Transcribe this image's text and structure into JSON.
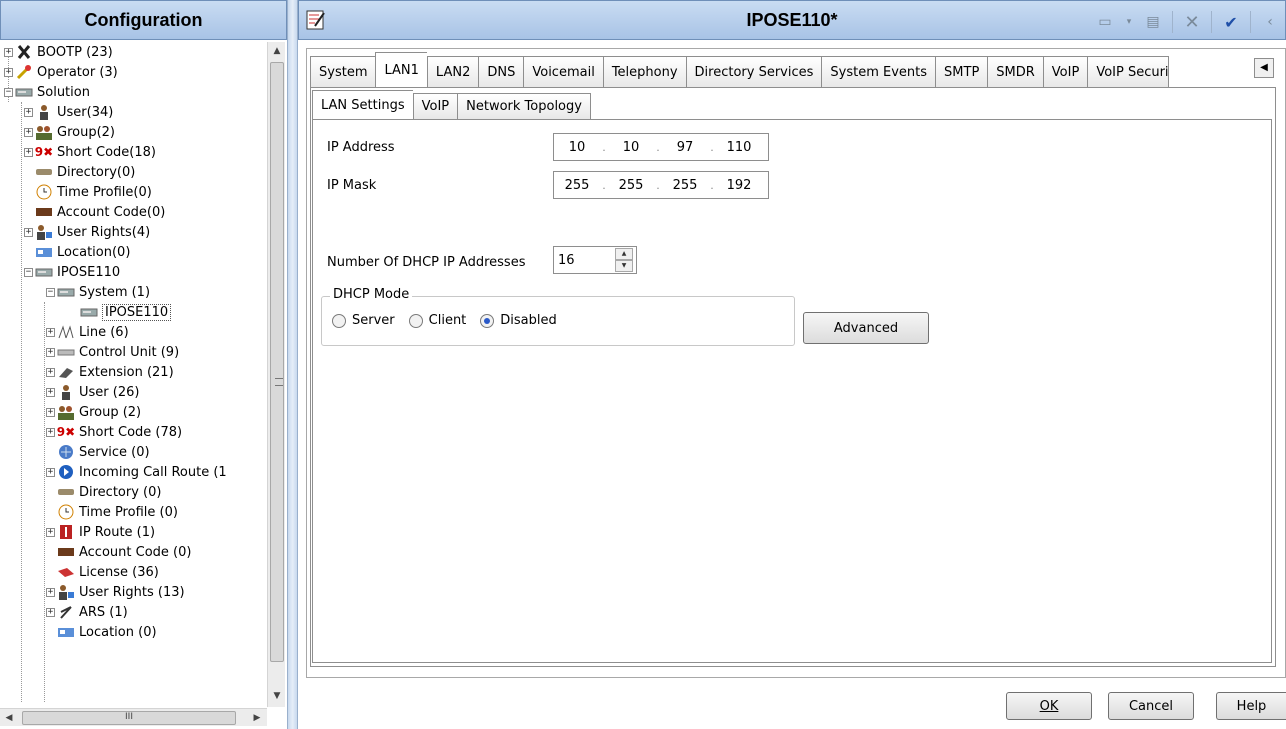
{
  "left_pane": {
    "title": "Configuration",
    "tree": [
      {
        "label": "BOOTP (23)",
        "icon": "bootp-icon",
        "exp": "+"
      },
      {
        "label": "Operator (3)",
        "icon": "operator-icon",
        "exp": "+"
      },
      {
        "label": "Solution",
        "icon": "solution-icon",
        "exp": "-"
      },
      {
        "label": "User(34)",
        "icon": "user-icon",
        "exp": "+"
      },
      {
        "label": "Group(2)",
        "icon": "group-icon",
        "exp": "+"
      },
      {
        "label": "Short Code(18)",
        "icon": "short-code-icon",
        "exp": "+"
      },
      {
        "label": "Directory(0)",
        "icon": "directory-icon",
        "exp": ""
      },
      {
        "label": "Time Profile(0)",
        "icon": "time-profile-icon",
        "exp": ""
      },
      {
        "label": "Account Code(0)",
        "icon": "account-code-icon",
        "exp": ""
      },
      {
        "label": "User Rights(4)",
        "icon": "user-rights-icon",
        "exp": "+"
      },
      {
        "label": "Location(0)",
        "icon": "location-icon",
        "exp": ""
      },
      {
        "label": "IPOSE110",
        "icon": "server-icon",
        "exp": "-"
      },
      {
        "label": "System (1)",
        "icon": "system-icon",
        "exp": "-"
      },
      {
        "label": "IPOSE110",
        "icon": "system-node-icon",
        "exp": ""
      },
      {
        "label": "Line (6)",
        "icon": "line-icon",
        "exp": "+"
      },
      {
        "label": "Control Unit (9)",
        "icon": "control-unit-icon",
        "exp": "+"
      },
      {
        "label": "Extension (21)",
        "icon": "extension-icon",
        "exp": "+"
      },
      {
        "label": "User (26)",
        "icon": "user-icon",
        "exp": "+"
      },
      {
        "label": "Group (2)",
        "icon": "group-icon",
        "exp": "+"
      },
      {
        "label": "Short Code (78)",
        "icon": "short-code-icon",
        "exp": "+"
      },
      {
        "label": "Service (0)",
        "icon": "service-icon",
        "exp": ""
      },
      {
        "label": "Incoming Call Route (1",
        "icon": "incoming-call-route-icon",
        "exp": "+"
      },
      {
        "label": "Directory (0)",
        "icon": "directory-icon",
        "exp": ""
      },
      {
        "label": "Time Profile (0)",
        "icon": "time-profile-icon",
        "exp": ""
      },
      {
        "label": "IP Route (1)",
        "icon": "ip-route-icon",
        "exp": "+"
      },
      {
        "label": "Account Code (0)",
        "icon": "account-code-icon",
        "exp": ""
      },
      {
        "label": "License (36)",
        "icon": "license-icon",
        "exp": ""
      },
      {
        "label": "User Rights (13)",
        "icon": "user-rights-icon",
        "exp": "+"
      },
      {
        "label": "ARS (1)",
        "icon": "ars-icon",
        "exp": "+"
      },
      {
        "label": "Location (0)",
        "icon": "location-icon",
        "exp": ""
      }
    ],
    "hscroll_grip": "III"
  },
  "title_bar": {
    "title": "IPOSE110*"
  },
  "tabs": [
    "System",
    "LAN1",
    "LAN2",
    "DNS",
    "Voicemail",
    "Telephony",
    "Directory Services",
    "System Events",
    "SMTP",
    "SMDR",
    "VoIP",
    "VoIP Securit"
  ],
  "active_tab": "LAN1",
  "subtabs": [
    "LAN Settings",
    "VoIP",
    "Network Topology"
  ],
  "active_subtab": "LAN Settings",
  "lan_settings": {
    "ip_address_label": "IP Address",
    "ip_address": [
      "10",
      "10",
      "97",
      "110"
    ],
    "ip_mask_label": "IP Mask",
    "ip_mask": [
      "255",
      "255",
      "255",
      "192"
    ],
    "dhcp_count_label": "Number Of DHCP IP Addresses",
    "dhcp_count": "16",
    "dhcp_mode_title": "DHCP Mode",
    "dhcp_modes": [
      "Server",
      "Client",
      "Disabled"
    ],
    "dhcp_mode_selected": "Disabled",
    "advanced_label": "Advanced"
  },
  "footer": {
    "ok": "OK",
    "cancel": "Cancel",
    "help": "Help"
  },
  "colors": {
    "header_gradient_top": "#c9dcf2",
    "header_gradient_bottom": "#a8c3e6",
    "radio_selected": "#2a59c8"
  }
}
